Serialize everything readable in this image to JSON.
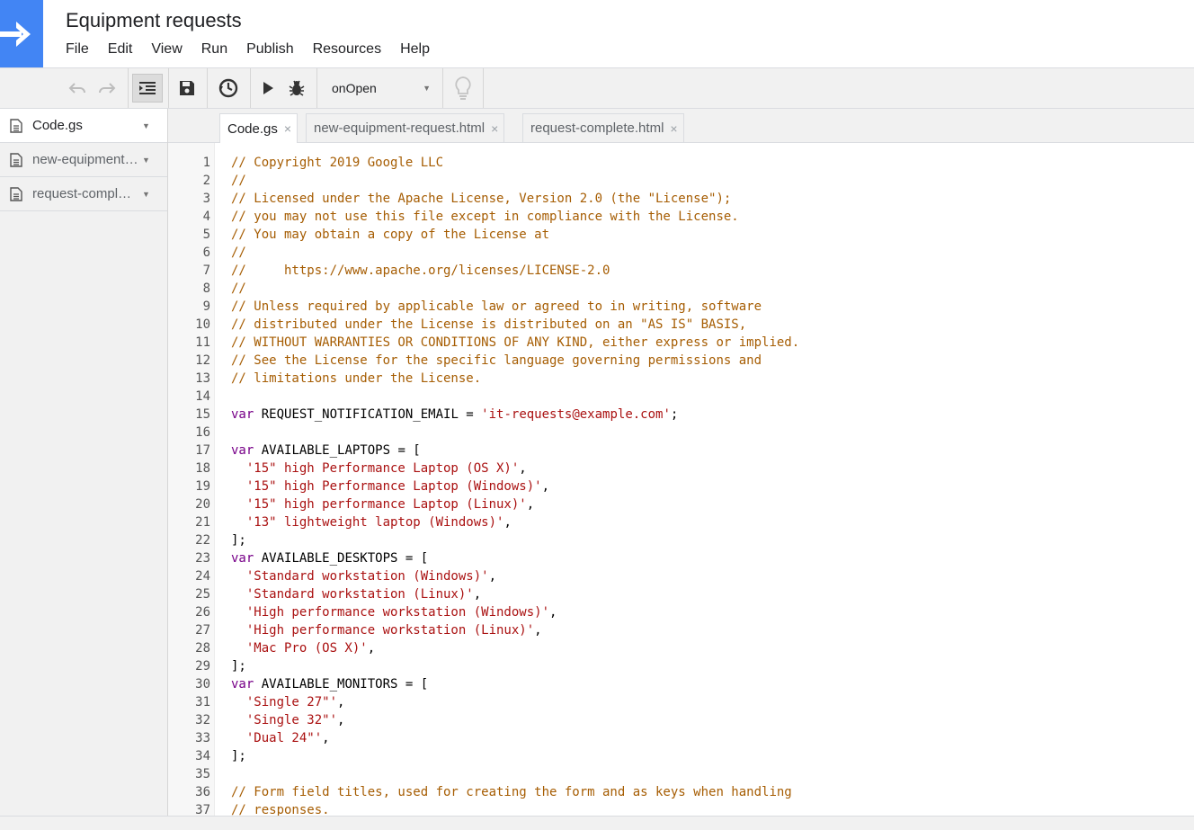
{
  "app": {
    "title": "Equipment requests",
    "brand_color": "#4285f4",
    "logo_icon": "arrow-right-icon"
  },
  "menu": [
    "File",
    "Edit",
    "View",
    "Run",
    "Publish",
    "Resources",
    "Help"
  ],
  "toolbar": {
    "function_select": "onOpen",
    "icons": [
      "undo-icon",
      "redo-icon",
      "indent-icon",
      "save-icon",
      "triggers-icon",
      "run-icon",
      "debug-icon",
      "lightbulb-icon"
    ]
  },
  "sidebar": {
    "files": [
      {
        "name": "Code.gs",
        "active": true
      },
      {
        "name": "new-equipment-request.html",
        "active": false
      },
      {
        "name": "request-complete.html",
        "active": false
      }
    ]
  },
  "tabs": [
    {
      "name": "Code.gs",
      "active": true
    },
    {
      "name": "new-equipment-request.html",
      "active": false
    },
    {
      "name": "request-complete.html",
      "active": false
    }
  ],
  "tab_close_glyph": "×",
  "code": {
    "lines": [
      [
        [
          "c",
          "// Copyright 2019 Google LLC"
        ]
      ],
      [
        [
          "c",
          "//"
        ]
      ],
      [
        [
          "c",
          "// Licensed under the Apache License, Version 2.0 (the \"License\");"
        ]
      ],
      [
        [
          "c",
          "// you may not use this file except in compliance with the License."
        ]
      ],
      [
        [
          "c",
          "// You may obtain a copy of the License at"
        ]
      ],
      [
        [
          "c",
          "//"
        ]
      ],
      [
        [
          "c",
          "//     https://www.apache.org/licenses/LICENSE-2.0"
        ]
      ],
      [
        [
          "c",
          "//"
        ]
      ],
      [
        [
          "c",
          "// Unless required by applicable law or agreed to in writing, software"
        ]
      ],
      [
        [
          "c",
          "// distributed under the License is distributed on an \"AS IS\" BASIS,"
        ]
      ],
      [
        [
          "c",
          "// WITHOUT WARRANTIES OR CONDITIONS OF ANY KIND, either express or implied."
        ]
      ],
      [
        [
          "c",
          "// See the License for the specific language governing permissions and"
        ]
      ],
      [
        [
          "c",
          "// limitations under the License."
        ]
      ],
      [],
      [
        [
          "k",
          "var"
        ],
        [
          "v",
          " REQUEST_NOTIFICATION_EMAIL = "
        ],
        [
          "s",
          "'it-requests@example.com'"
        ],
        [
          "v",
          ";"
        ]
      ],
      [],
      [
        [
          "k",
          "var"
        ],
        [
          "v",
          " AVAILABLE_LAPTOPS = ["
        ]
      ],
      [
        [
          "v",
          "  "
        ],
        [
          "s",
          "'15\" high Performance Laptop (OS X)'"
        ],
        [
          "v",
          ","
        ]
      ],
      [
        [
          "v",
          "  "
        ],
        [
          "s",
          "'15\" high Performance Laptop (Windows)'"
        ],
        [
          "v",
          ","
        ]
      ],
      [
        [
          "v",
          "  "
        ],
        [
          "s",
          "'15\" high performance Laptop (Linux)'"
        ],
        [
          "v",
          ","
        ]
      ],
      [
        [
          "v",
          "  "
        ],
        [
          "s",
          "'13\" lightweight laptop (Windows)'"
        ],
        [
          "v",
          ","
        ]
      ],
      [
        [
          "v",
          "];"
        ]
      ],
      [
        [
          "k",
          "var"
        ],
        [
          "v",
          " AVAILABLE_DESKTOPS = ["
        ]
      ],
      [
        [
          "v",
          "  "
        ],
        [
          "s",
          "'Standard workstation (Windows)'"
        ],
        [
          "v",
          ","
        ]
      ],
      [
        [
          "v",
          "  "
        ],
        [
          "s",
          "'Standard workstation (Linux)'"
        ],
        [
          "v",
          ","
        ]
      ],
      [
        [
          "v",
          "  "
        ],
        [
          "s",
          "'High performance workstation (Windows)'"
        ],
        [
          "v",
          ","
        ]
      ],
      [
        [
          "v",
          "  "
        ],
        [
          "s",
          "'High performance workstation (Linux)'"
        ],
        [
          "v",
          ","
        ]
      ],
      [
        [
          "v",
          "  "
        ],
        [
          "s",
          "'Mac Pro (OS X)'"
        ],
        [
          "v",
          ","
        ]
      ],
      [
        [
          "v",
          "];"
        ]
      ],
      [
        [
          "k",
          "var"
        ],
        [
          "v",
          " AVAILABLE_MONITORS = ["
        ]
      ],
      [
        [
          "v",
          "  "
        ],
        [
          "s",
          "'Single 27\"'"
        ],
        [
          "v",
          ","
        ]
      ],
      [
        [
          "v",
          "  "
        ],
        [
          "s",
          "'Single 32\"'"
        ],
        [
          "v",
          ","
        ]
      ],
      [
        [
          "v",
          "  "
        ],
        [
          "s",
          "'Dual 24\"'"
        ],
        [
          "v",
          ","
        ]
      ],
      [
        [
          "v",
          "];"
        ]
      ],
      [],
      [
        [
          "c",
          "// Form field titles, used for creating the form and as keys when handling"
        ]
      ],
      [
        [
          "c",
          "// responses."
        ]
      ]
    ]
  },
  "colors": {
    "comment": "#a65d03",
    "keyword": "#770088",
    "string": "#aa1111"
  }
}
